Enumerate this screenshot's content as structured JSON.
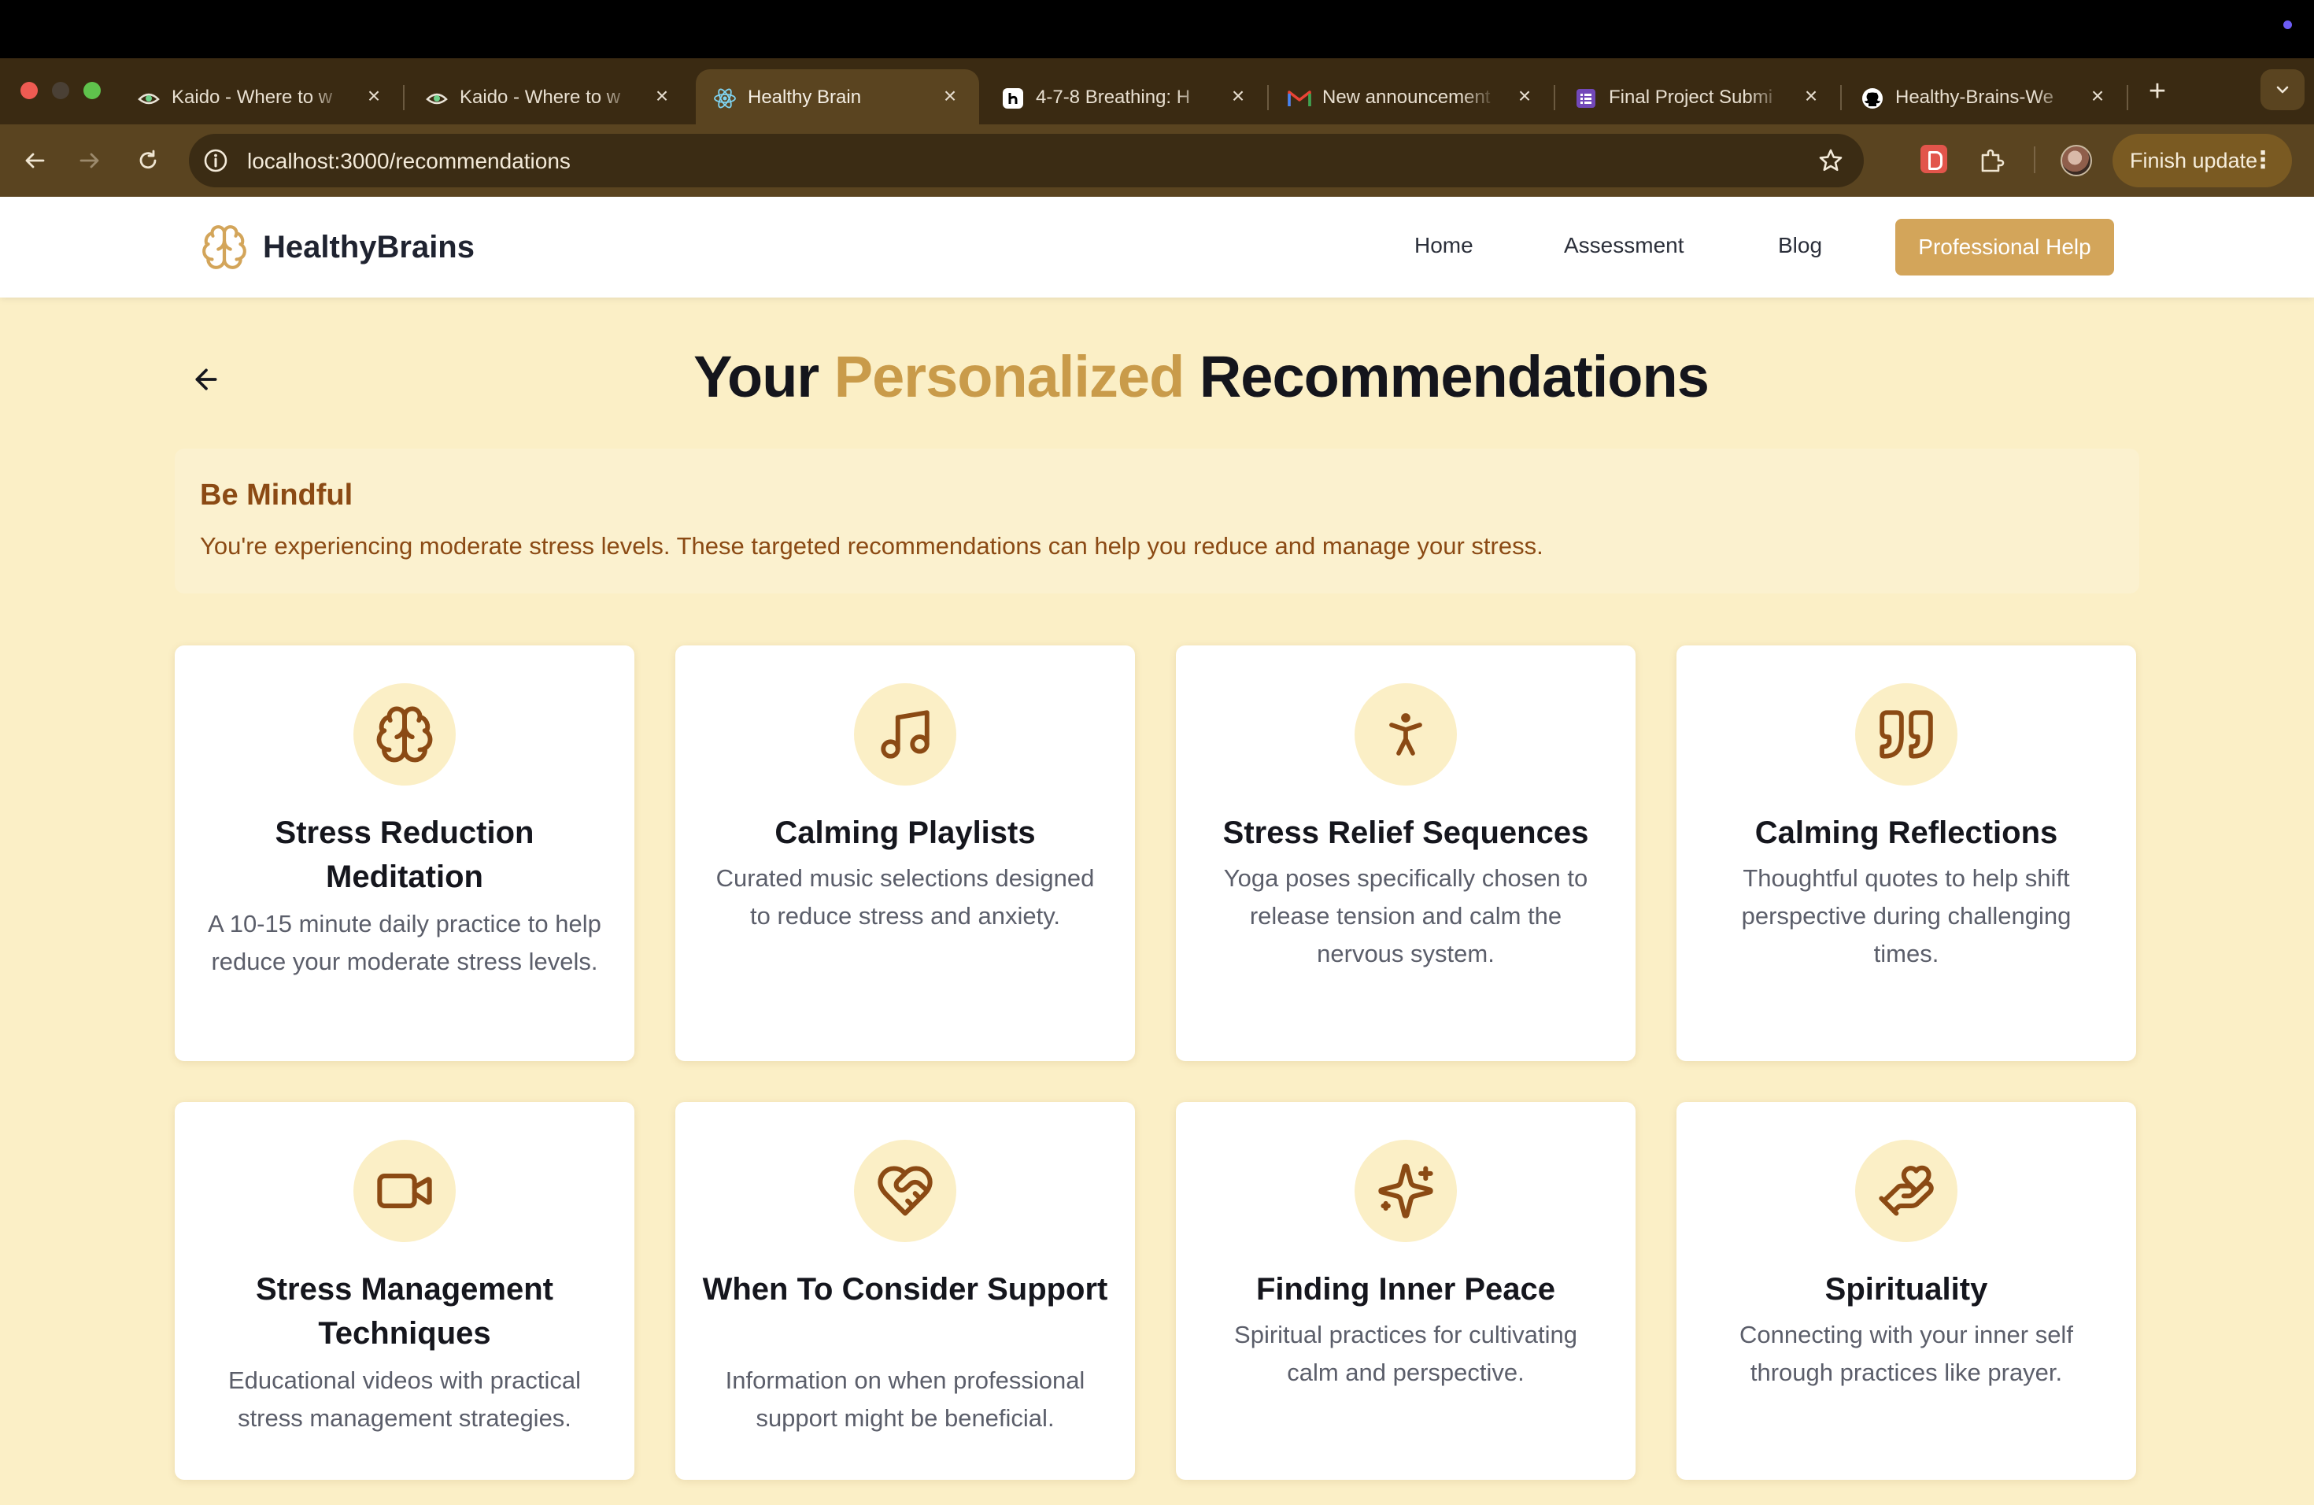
{
  "browser": {
    "tabs": [
      {
        "title": "Kaido - Where to w",
        "icon": "kaido-icon"
      },
      {
        "title": "Kaido - Where to w",
        "icon": "kaido-icon"
      },
      {
        "title": "Healthy Brain",
        "icon": "react-icon",
        "active": true
      },
      {
        "title": "4-7-8 Breathing: H",
        "icon": "h-icon"
      },
      {
        "title": "New announcement",
        "icon": "gmail-icon"
      },
      {
        "title": "Final Project Submi",
        "icon": "forms-icon"
      },
      {
        "title": "Healthy-Brains-We",
        "icon": "github-icon"
      }
    ],
    "url": "localhost:3000/recommendations",
    "finish_update_label": "Finish update"
  },
  "nav": {
    "brand": "HealthyBrains",
    "links": [
      "Home",
      "Assessment",
      "Blog"
    ],
    "cta": "Professional Help"
  },
  "headline": {
    "part1": "Your",
    "accent": "Personalized",
    "part2": "Recommendations"
  },
  "banner": {
    "title": "Be Mindful",
    "text": "You're experiencing moderate stress levels. These targeted recommendations can help you reduce and manage your stress."
  },
  "cards": [
    {
      "icon": "brain-icon",
      "title": "Stress Reduction Meditation",
      "description": "A 10-15 minute daily practice to help reduce your moderate stress levels."
    },
    {
      "icon": "music-note-icon",
      "title": "Calming Playlists",
      "description": "Curated music selections designed to reduce stress and anxiety."
    },
    {
      "icon": "person-standing-icon",
      "title": "Stress Relief Sequences",
      "description": "Yoga poses specifically chosen to release tension and calm the nervous system."
    },
    {
      "icon": "quote-icon",
      "title": "Calming Reflections",
      "description": "Thoughtful quotes to help shift perspective during challenging times."
    },
    {
      "icon": "video-camera-icon",
      "title": "Stress Management Techniques",
      "description": "Educational videos with practical stress management strategies."
    },
    {
      "icon": "heart-handshake-icon",
      "title": "When To Consider Support",
      "description": "Information on when professional support might be beneficial."
    },
    {
      "icon": "sparkles-icon",
      "title": "Finding Inner Peace",
      "description": "Spiritual practices for cultivating calm and perspective."
    },
    {
      "icon": "hand-heart-icon",
      "title": "Spirituality",
      "description": "Connecting with your inner self through practices like prayer."
    }
  ],
  "colors": {
    "accent": "#c99b4a",
    "page_background": "#fbefc6",
    "banner_text": "#8b4a14",
    "cta_background": "#d3a55a",
    "icon_stroke": "#8b4a14"
  }
}
